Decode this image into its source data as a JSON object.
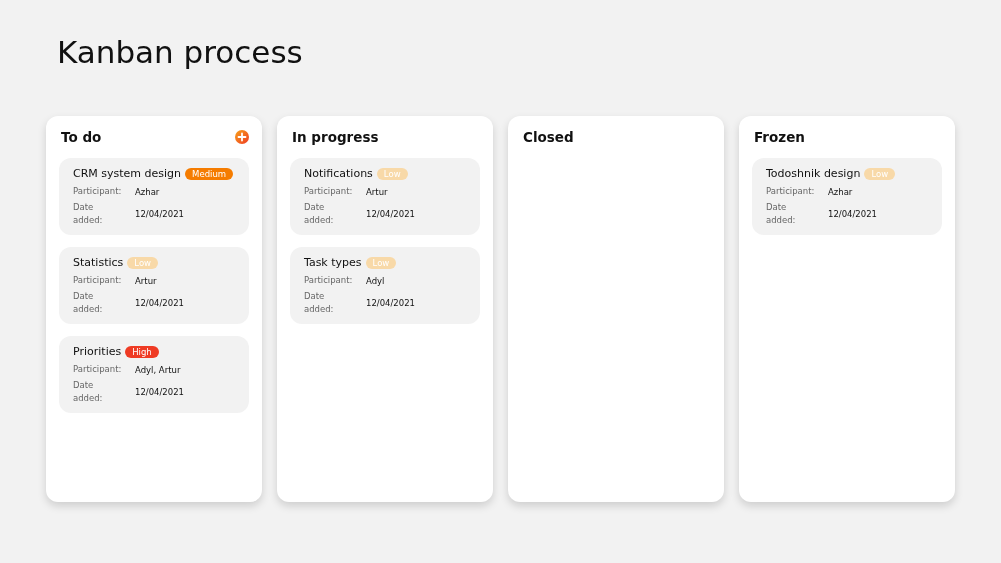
{
  "title": "Kanban process",
  "columns": [
    {
      "name": "To do",
      "add_button": true,
      "cards": [
        {
          "title": "CRM system design",
          "priority": {
            "label": "Medium",
            "color": "#f57c00"
          },
          "participant_label": "Participant:",
          "participant": "Azhar",
          "date_label": "Date added:",
          "date": "12/04/2021"
        },
        {
          "title": "Statistics",
          "priority": {
            "label": "Low",
            "color": "#f8d9a8"
          },
          "participant_label": "Participant:",
          "participant": "Artur",
          "date_label": "Date added:",
          "date": "12/04/2021"
        },
        {
          "title": "Priorities",
          "priority": {
            "label": "High",
            "color": "#ef3b24"
          },
          "participant_label": "Participant:",
          "participant": "Adyl, Artur",
          "date_label": "Date added:",
          "date": "12/04/2021"
        }
      ]
    },
    {
      "name": "In progress",
      "add_button": false,
      "cards": [
        {
          "title": "Notifications",
          "priority": {
            "label": "Low",
            "color": "#f8d9a8"
          },
          "participant_label": "Participant:",
          "participant": "Artur",
          "date_label": "Date added:",
          "date": "12/04/2021"
        },
        {
          "title": "Task types",
          "priority": {
            "label": "Low",
            "color": "#f8d9a8"
          },
          "participant_label": "Participant:",
          "participant": "Adyl",
          "date_label": "Date added:",
          "date": "12/04/2021"
        }
      ]
    },
    {
      "name": "Closed",
      "add_button": false
    },
    {
      "name": "Frozen",
      "add_button": false,
      "cards": [
        {
          "title": "Todoshnik design",
          "priority": {
            "label": "Low",
            "color": "#f8d9a8"
          },
          "participant_label": "Participant:",
          "participant": "Azhar",
          "date_label": "Date added:",
          "date": "12/04/2021"
        }
      ]
    }
  ]
}
